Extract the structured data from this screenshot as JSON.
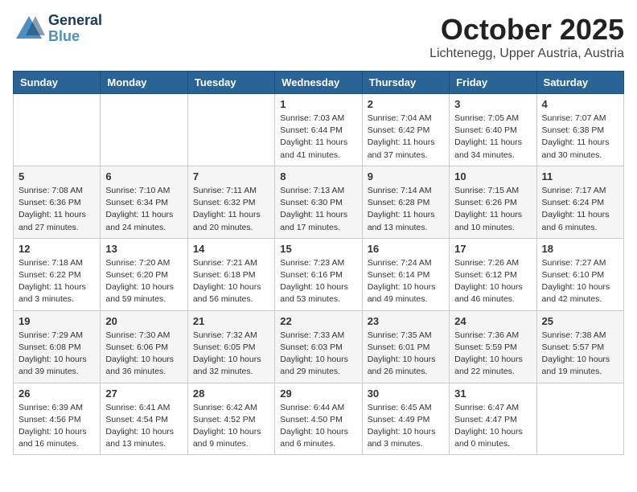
{
  "header": {
    "logo_general": "General",
    "logo_blue": "Blue",
    "month": "October 2025",
    "location": "Lichtenegg, Upper Austria, Austria"
  },
  "weekdays": [
    "Sunday",
    "Monday",
    "Tuesday",
    "Wednesday",
    "Thursday",
    "Friday",
    "Saturday"
  ],
  "weeks": [
    [
      {
        "day": "",
        "info": ""
      },
      {
        "day": "",
        "info": ""
      },
      {
        "day": "",
        "info": ""
      },
      {
        "day": "1",
        "info": "Sunrise: 7:03 AM\nSunset: 6:44 PM\nDaylight: 11 hours and 41 minutes."
      },
      {
        "day": "2",
        "info": "Sunrise: 7:04 AM\nSunset: 6:42 PM\nDaylight: 11 hours and 37 minutes."
      },
      {
        "day": "3",
        "info": "Sunrise: 7:05 AM\nSunset: 6:40 PM\nDaylight: 11 hours and 34 minutes."
      },
      {
        "day": "4",
        "info": "Sunrise: 7:07 AM\nSunset: 6:38 PM\nDaylight: 11 hours and 30 minutes."
      }
    ],
    [
      {
        "day": "5",
        "info": "Sunrise: 7:08 AM\nSunset: 6:36 PM\nDaylight: 11 hours and 27 minutes."
      },
      {
        "day": "6",
        "info": "Sunrise: 7:10 AM\nSunset: 6:34 PM\nDaylight: 11 hours and 24 minutes."
      },
      {
        "day": "7",
        "info": "Sunrise: 7:11 AM\nSunset: 6:32 PM\nDaylight: 11 hours and 20 minutes."
      },
      {
        "day": "8",
        "info": "Sunrise: 7:13 AM\nSunset: 6:30 PM\nDaylight: 11 hours and 17 minutes."
      },
      {
        "day": "9",
        "info": "Sunrise: 7:14 AM\nSunset: 6:28 PM\nDaylight: 11 hours and 13 minutes."
      },
      {
        "day": "10",
        "info": "Sunrise: 7:15 AM\nSunset: 6:26 PM\nDaylight: 11 hours and 10 minutes."
      },
      {
        "day": "11",
        "info": "Sunrise: 7:17 AM\nSunset: 6:24 PM\nDaylight: 11 hours and 6 minutes."
      }
    ],
    [
      {
        "day": "12",
        "info": "Sunrise: 7:18 AM\nSunset: 6:22 PM\nDaylight: 11 hours and 3 minutes."
      },
      {
        "day": "13",
        "info": "Sunrise: 7:20 AM\nSunset: 6:20 PM\nDaylight: 10 hours and 59 minutes."
      },
      {
        "day": "14",
        "info": "Sunrise: 7:21 AM\nSunset: 6:18 PM\nDaylight: 10 hours and 56 minutes."
      },
      {
        "day": "15",
        "info": "Sunrise: 7:23 AM\nSunset: 6:16 PM\nDaylight: 10 hours and 53 minutes."
      },
      {
        "day": "16",
        "info": "Sunrise: 7:24 AM\nSunset: 6:14 PM\nDaylight: 10 hours and 49 minutes."
      },
      {
        "day": "17",
        "info": "Sunrise: 7:26 AM\nSunset: 6:12 PM\nDaylight: 10 hours and 46 minutes."
      },
      {
        "day": "18",
        "info": "Sunrise: 7:27 AM\nSunset: 6:10 PM\nDaylight: 10 hours and 42 minutes."
      }
    ],
    [
      {
        "day": "19",
        "info": "Sunrise: 7:29 AM\nSunset: 6:08 PM\nDaylight: 10 hours and 39 minutes."
      },
      {
        "day": "20",
        "info": "Sunrise: 7:30 AM\nSunset: 6:06 PM\nDaylight: 10 hours and 36 minutes."
      },
      {
        "day": "21",
        "info": "Sunrise: 7:32 AM\nSunset: 6:05 PM\nDaylight: 10 hours and 32 minutes."
      },
      {
        "day": "22",
        "info": "Sunrise: 7:33 AM\nSunset: 6:03 PM\nDaylight: 10 hours and 29 minutes."
      },
      {
        "day": "23",
        "info": "Sunrise: 7:35 AM\nSunset: 6:01 PM\nDaylight: 10 hours and 26 minutes."
      },
      {
        "day": "24",
        "info": "Sunrise: 7:36 AM\nSunset: 5:59 PM\nDaylight: 10 hours and 22 minutes."
      },
      {
        "day": "25",
        "info": "Sunrise: 7:38 AM\nSunset: 5:57 PM\nDaylight: 10 hours and 19 minutes."
      }
    ],
    [
      {
        "day": "26",
        "info": "Sunrise: 6:39 AM\nSunset: 4:56 PM\nDaylight: 10 hours and 16 minutes."
      },
      {
        "day": "27",
        "info": "Sunrise: 6:41 AM\nSunset: 4:54 PM\nDaylight: 10 hours and 13 minutes."
      },
      {
        "day": "28",
        "info": "Sunrise: 6:42 AM\nSunset: 4:52 PM\nDaylight: 10 hours and 9 minutes."
      },
      {
        "day": "29",
        "info": "Sunrise: 6:44 AM\nSunset: 4:50 PM\nDaylight: 10 hours and 6 minutes."
      },
      {
        "day": "30",
        "info": "Sunrise: 6:45 AM\nSunset: 4:49 PM\nDaylight: 10 hours and 3 minutes."
      },
      {
        "day": "31",
        "info": "Sunrise: 6:47 AM\nSunset: 4:47 PM\nDaylight: 10 hours and 0 minutes."
      },
      {
        "day": "",
        "info": ""
      }
    ]
  ]
}
